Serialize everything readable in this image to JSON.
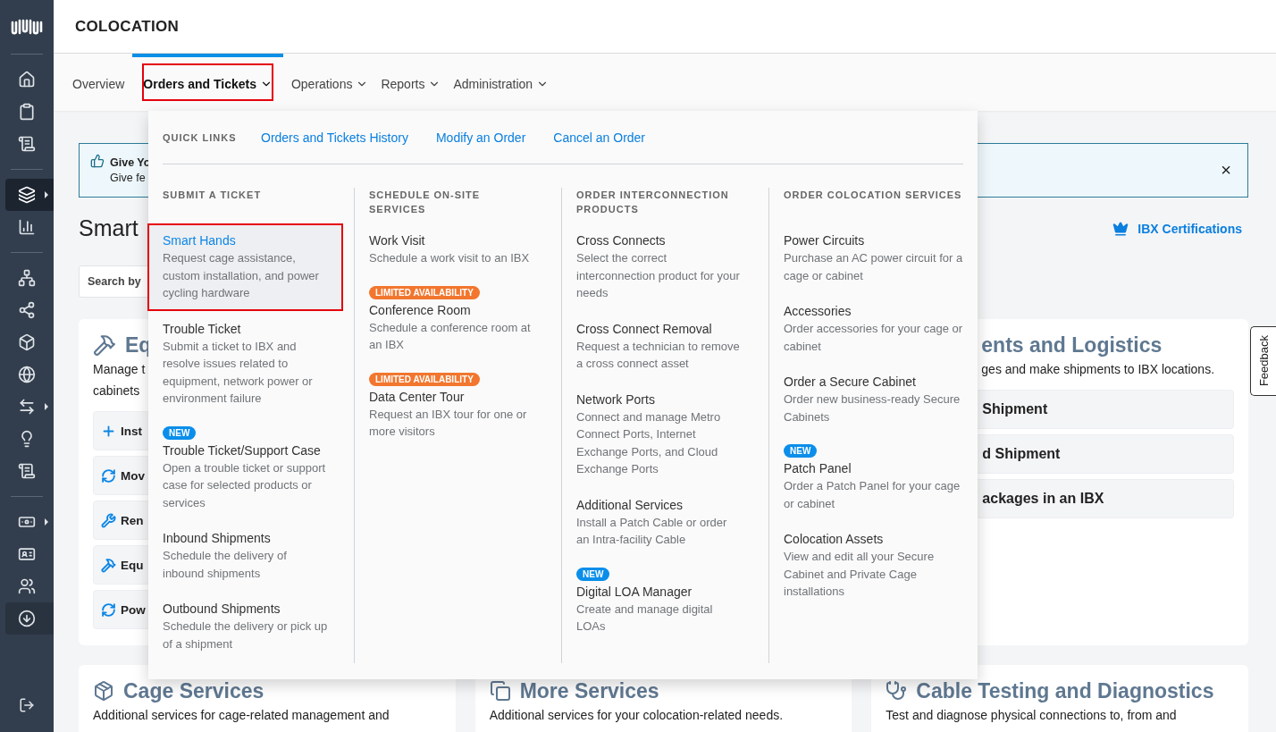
{
  "header": {
    "title": "COLOCATION"
  },
  "sidebar": {
    "groups": [
      {
        "items": [
          {
            "selected": false,
            "hovered": false,
            "submenu": false
          },
          {
            "selected": false,
            "hovered": false,
            "submenu": false
          },
          {
            "selected": false,
            "hovered": false,
            "submenu": false
          }
        ]
      },
      {
        "items": [
          {
            "selected": true,
            "hovered": false,
            "submenu": true
          },
          {
            "selected": false,
            "hovered": false,
            "submenu": false
          }
        ]
      },
      {
        "items": [
          {
            "selected": false,
            "hovered": false,
            "submenu": false
          },
          {
            "selected": false,
            "hovered": false,
            "submenu": false
          },
          {
            "selected": false,
            "hovered": false,
            "submenu": false
          },
          {
            "selected": false,
            "hovered": false,
            "submenu": false
          },
          {
            "selected": false,
            "hovered": false,
            "submenu": true
          },
          {
            "selected": false,
            "hovered": false,
            "submenu": false
          },
          {
            "selected": false,
            "hovered": false,
            "submenu": false
          }
        ]
      },
      {
        "items": [
          {
            "selected": false,
            "hovered": false,
            "submenu": true
          },
          {
            "selected": false,
            "hovered": false,
            "submenu": false
          },
          {
            "selected": false,
            "hovered": false,
            "submenu": false
          },
          {
            "selected": false,
            "hovered": true,
            "submenu": false
          }
        ]
      }
    ]
  },
  "nav": {
    "tabs": [
      {
        "label": "Overview",
        "selected": false,
        "highlighted": false,
        "has_menu": false
      },
      {
        "label": "Orders and Tickets",
        "selected": true,
        "highlighted": true,
        "has_menu": true
      },
      {
        "label": "Operations",
        "selected": false,
        "highlighted": false,
        "has_menu": true
      },
      {
        "label": "Reports",
        "selected": false,
        "highlighted": false,
        "has_menu": true
      },
      {
        "label": "Administration",
        "selected": false,
        "highlighted": false,
        "has_menu": true
      }
    ]
  },
  "menu": {
    "quick_links": {
      "label": "QUICK LINKS",
      "links": [
        "Orders and Tickets History",
        "Modify an Order",
        "Cancel an Order"
      ]
    },
    "columns": [
      {
        "heading": "SUBMIT A TICKET",
        "items": [
          {
            "title": "Smart Hands",
            "description": "Request cage assistance, custom installation, and power cycling hardware",
            "selected": true,
            "highlighted": true
          },
          {
            "title": "Trouble Ticket",
            "description": "Submit a ticket to IBX and resolve issues related to equipment, network power or environment failure",
            "selected": false,
            "highlighted": false
          },
          {
            "badge": {
              "text": "NEW",
              "kind": "new"
            },
            "title": "Trouble Ticket/Support Case",
            "description": "Open a trouble ticket or support case for selected products or services",
            "selected": false,
            "highlighted": false
          },
          {
            "title": "Inbound Shipments",
            "description": "Schedule the delivery of inbound shipments",
            "selected": false,
            "highlighted": false
          },
          {
            "title": "Outbound Shipments",
            "description": "Schedule the delivery or pick up of a shipment",
            "selected": false,
            "highlighted": false
          }
        ]
      },
      {
        "heading": "SCHEDULE ON-SITE SERVICES",
        "items": [
          {
            "title": "Work Visit",
            "description": "Schedule a work visit to an IBX",
            "selected": false,
            "highlighted": false
          },
          {
            "badge": {
              "text": "LIMITED AVAILABILITY",
              "kind": "limited"
            },
            "title": "Conference Room",
            "description": "Schedule a conference room at an IBX",
            "selected": false,
            "highlighted": false
          },
          {
            "badge": {
              "text": "LIMITED AVAILABILITY",
              "kind": "limited"
            },
            "title": "Data Center Tour",
            "description": "Request an IBX tour for one or more visitors",
            "selected": false,
            "highlighted": false
          }
        ]
      },
      {
        "heading": "ORDER INTERCONNECTION PRODUCTS",
        "items": [
          {
            "title": "Cross Connects",
            "description": "Select the correct interconnection product for your needs",
            "selected": false,
            "highlighted": false
          },
          {
            "title": "Cross Connect Removal",
            "description": "Request a technician to remove a cross connect asset",
            "selected": false,
            "highlighted": false
          },
          {
            "title": "Network Ports",
            "description": "Connect and manage Metro Connect Ports, Internet Exchange Ports, and Cloud Exchange Ports",
            "selected": false,
            "highlighted": false
          },
          {
            "title": "Additional Services",
            "description": "Install a Patch Cable or order an Intra-facility Cable",
            "selected": false,
            "highlighted": false
          },
          {
            "badge": {
              "text": "NEW",
              "kind": "new"
            },
            "title": "Digital LOA Manager",
            "description": "Create and manage digital LOAs",
            "selected": false,
            "highlighted": false
          }
        ]
      },
      {
        "heading": "ORDER COLOCATION SERVICES",
        "items": [
          {
            "title": "Power Circuits",
            "description": "Purchase an AC power circuit for a cage or cabinet",
            "selected": false,
            "highlighted": false
          },
          {
            "title": "Accessories",
            "description": "Order accessories for your cage or cabinet",
            "selected": false,
            "highlighted": false
          },
          {
            "title": "Order a Secure Cabinet",
            "description": "Order new business-ready Secure Cabinets",
            "selected": false,
            "highlighted": false
          },
          {
            "badge": {
              "text": "NEW",
              "kind": "new"
            },
            "title": "Patch Panel",
            "description": "Order a Patch Panel for your cage or cabinet",
            "selected": false,
            "highlighted": false
          },
          {
            "title": "Colocation Assets",
            "description": "View and edit all your Secure Cabinet and Private Cage installations",
            "selected": false,
            "highlighted": false
          }
        ]
      }
    ]
  },
  "page": {
    "banner": {
      "title": "Give Yo",
      "text": "Give fe"
    },
    "heading": "Smart",
    "certifications_link": "IBX Certifications",
    "search": {
      "placeholder": "Search by"
    },
    "cards": [
      {
        "title": "Eq",
        "lines": [
          "Manage t",
          "cabinets"
        ],
        "clipped": false,
        "actions": [
          {
            "label": "Inst"
          },
          {
            "label": "Mov"
          },
          {
            "label": "Ren"
          },
          {
            "label": "Equ"
          },
          {
            "label": "Pow"
          }
        ]
      },
      {
        "title": "ents and Logistics",
        "lines": [
          "ges and make shipments to IBX locations."
        ],
        "clipped": true,
        "actions": [
          {
            "label": "Shipment"
          },
          {
            "label": "d Shipment"
          },
          {
            "label": "ackages in an IBX"
          }
        ]
      }
    ],
    "lower_cards": [
      {
        "title": "Cage Services",
        "lines": [
          "Additional services for cage-related management and"
        ]
      },
      {
        "title": "More Services",
        "lines": [
          "Additional services for your colocation-related needs."
        ]
      },
      {
        "title": "Cable Testing and Diagnostics",
        "lines": [
          "Test and diagnose physical connections to, from and"
        ]
      }
    ],
    "banner_close": "×",
    "feedback_tab": "Feedback"
  }
}
